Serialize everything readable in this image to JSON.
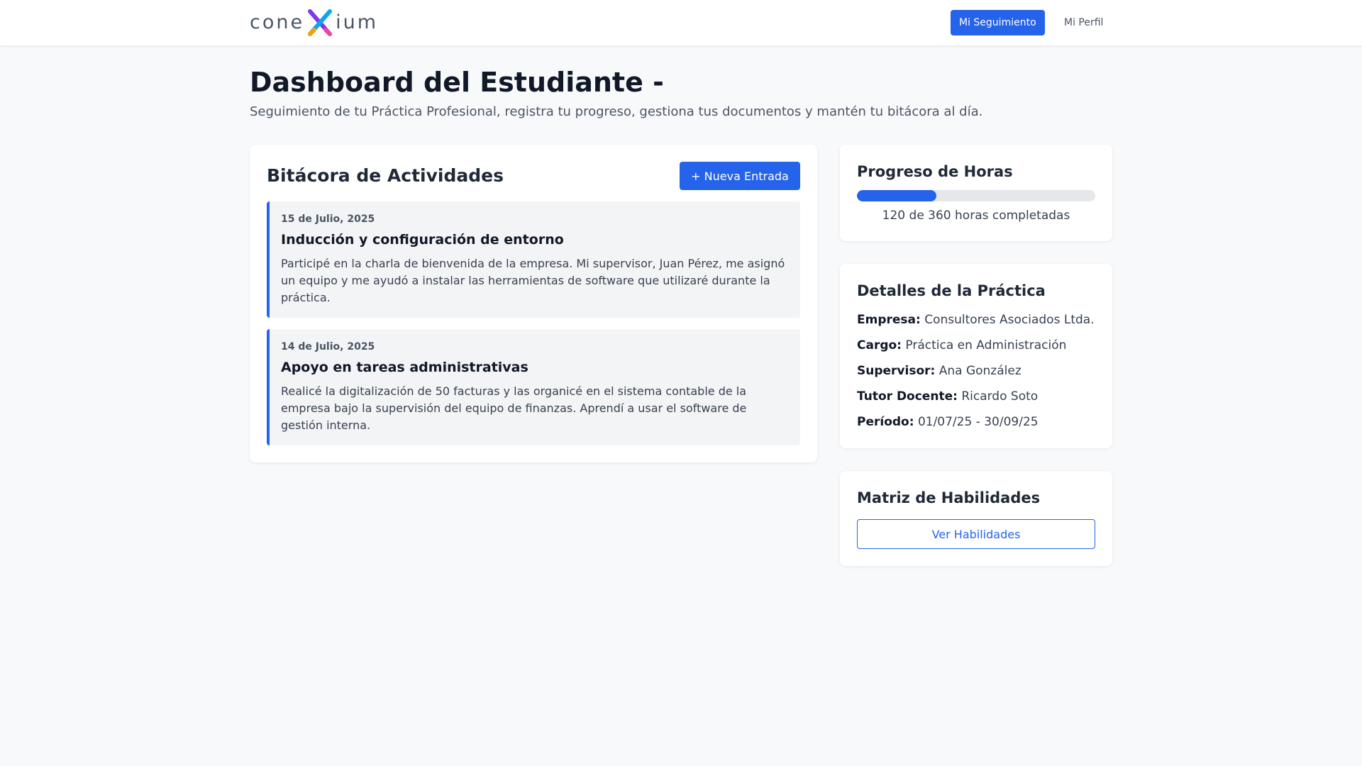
{
  "brand": {
    "logo_text_left": "cone",
    "logo_text_right": "ium"
  },
  "nav": {
    "primary_label": "Mi Seguimiento",
    "profile_label": "Mi Perfil"
  },
  "header": {
    "title": "Dashboard del Estudiante -",
    "subtitle": "Seguimiento de tu Práctica Profesional, registra tu progreso, gestiona tus documentos y mantén tu bitácora al día."
  },
  "log": {
    "title": "Bitácora de Actividades",
    "new_button": "+ Nueva Entrada",
    "entries": [
      {
        "date": "15 de Julio, 2025",
        "title": "Inducción y configuración de entorno",
        "text": "Participé en la charla de bienvenida de la empresa. Mi supervisor, Juan Pérez, me asignó un equipo y me ayudó a instalar las herramientas de software que utilizaré durante la práctica."
      },
      {
        "date": "14 de Julio, 2025",
        "title": "Apoyo en tareas administrativas",
        "text": "Realicé la digitalización de 50 facturas y las organicé en el sistema contable de la empresa bajo la supervisión del equipo de finanzas. Aprendí a usar el software de gestión interna."
      }
    ]
  },
  "progress": {
    "title": "Progreso de Horas",
    "completed_hours": 120,
    "total_hours": 360,
    "text": "120 de 360 horas completadas",
    "accent": "#2563eb"
  },
  "details": {
    "title": "Detalles de la Práctica",
    "rows": [
      {
        "label": "Empresa:",
        "value": "Consultores Asociados Ltda."
      },
      {
        "label": "Cargo:",
        "value": "Práctica en Administración"
      },
      {
        "label": "Supervisor:",
        "value": "Ana González"
      },
      {
        "label": "Tutor Docente:",
        "value": "Ricardo Soto"
      },
      {
        "label": "Período:",
        "value": "01/07/25 - 30/09/25"
      }
    ]
  },
  "skills": {
    "title": "Matriz de Habilidades",
    "button": "Ver Habilidades"
  }
}
